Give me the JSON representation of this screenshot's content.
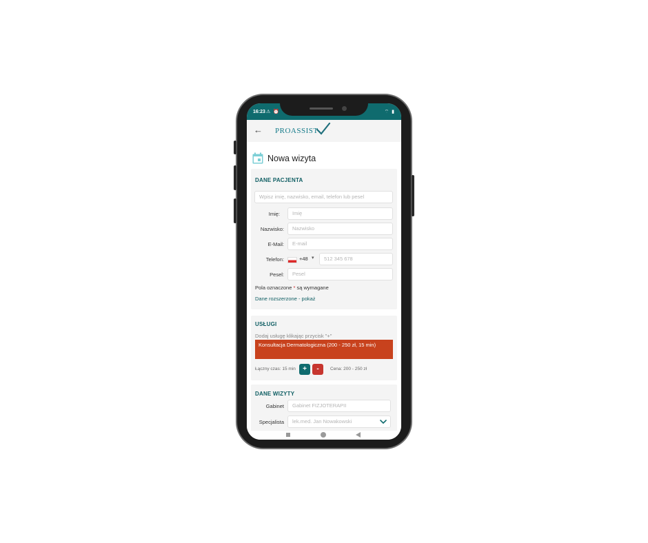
{
  "status_bar": {
    "time": "16:23",
    "left_icons": "⚠ ⏰",
    "right_icons": "⌔ ▮"
  },
  "header": {
    "logo_text": "PROASSIST",
    "back_icon": "arrow-left-icon"
  },
  "page": {
    "title": "Nowa wizyta"
  },
  "patient": {
    "section_title": "DANE PACJENTA",
    "search_placeholder": "Wpisz imię, nazwisko, email, telefon lub pesel",
    "first_name_label": "Imię:",
    "first_name_placeholder": "Imię",
    "last_name_label": "Nazwisko:",
    "last_name_placeholder": "Nazwisko",
    "email_label": "E-Mail:",
    "email_placeholder": "E-mail",
    "phone_label": "Telefon:",
    "phone_prefix": "+48",
    "phone_placeholder": "512 345 678",
    "pesel_label": "Pesel:",
    "pesel_placeholder": "Pesel",
    "required_note_pre": "Pola oznaczone ",
    "required_star": "*",
    "required_note_post": " są wymagane",
    "extended_link": "Dane rozszerzone - pokaż"
  },
  "services": {
    "section_title": "USŁUGI",
    "hint": "Dodaj usługę klikając przycisk \"+\"",
    "items": [
      {
        "label": "Konsultacja Dermatologiczna (200 - 250 zł, 15 min)"
      }
    ],
    "total_time": "Łączny czas: 15 min",
    "add_label": "+",
    "remove_label": "-",
    "price": "Cena: 200 - 250 zł"
  },
  "visit": {
    "section_title": "DANE WIZYTY",
    "office_label": "Gabinet",
    "office_value": "Gabinet FIZJOTERAPII",
    "specialist_label": "Specjalista",
    "specialist_value": "lek.med. Jan Nowakowski"
  },
  "colors": {
    "brand": "#0f6b6e",
    "accent": "#c8421d",
    "remove": "#c7362f"
  }
}
